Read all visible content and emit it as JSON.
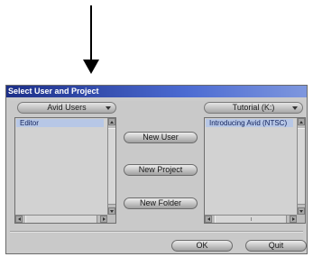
{
  "dialog": {
    "title": "Select User and Project"
  },
  "users": {
    "dropdown_label": "Avid Users",
    "items": [
      "Editor"
    ]
  },
  "projects": {
    "dropdown_label": "Tutorial (K:)",
    "items": [
      "Introducing Avid (NTSC)"
    ]
  },
  "actions": {
    "new_user": "New User",
    "new_project": "New Project",
    "new_folder": "New Folder"
  },
  "footer": {
    "ok": "OK",
    "quit": "Quit"
  },
  "colors": {
    "titlebar_start": "#1c2f88",
    "titlebar_end": "#7e97de",
    "selection": "#b7c7e6"
  }
}
